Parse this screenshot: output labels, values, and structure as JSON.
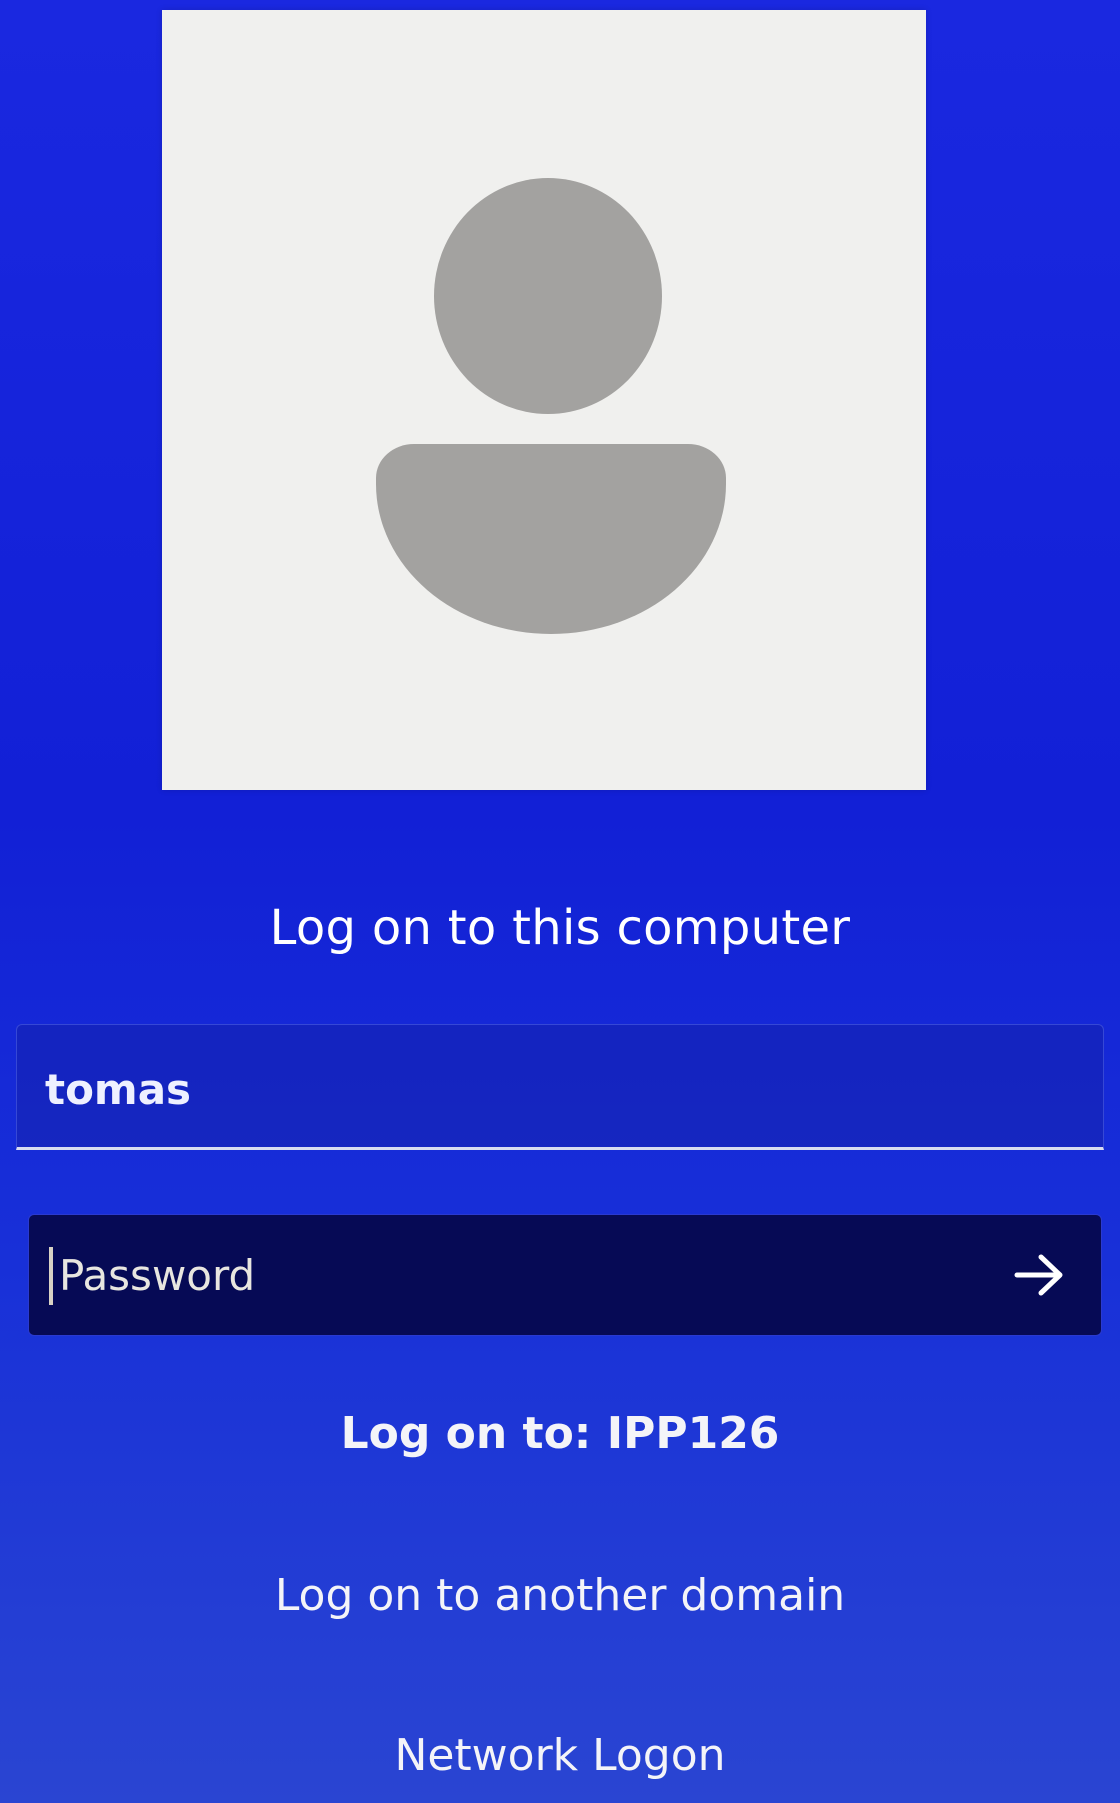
{
  "avatar": {
    "icon": "user-silhouette-icon"
  },
  "heading": "Log on to this computer",
  "username": {
    "value": "tomas"
  },
  "password": {
    "placeholder": "Password",
    "submit_icon": "arrow-right-icon"
  },
  "logon_target": "Log on to: IPP126",
  "another_domain_link": "Log on to another domain",
  "network_logon_link": "Network Logon",
  "colors": {
    "background": "#1220d6",
    "password_field": "#060a55",
    "avatar_tile": "#f0f0ee",
    "avatar_silhouette": "#a3a2a0"
  }
}
